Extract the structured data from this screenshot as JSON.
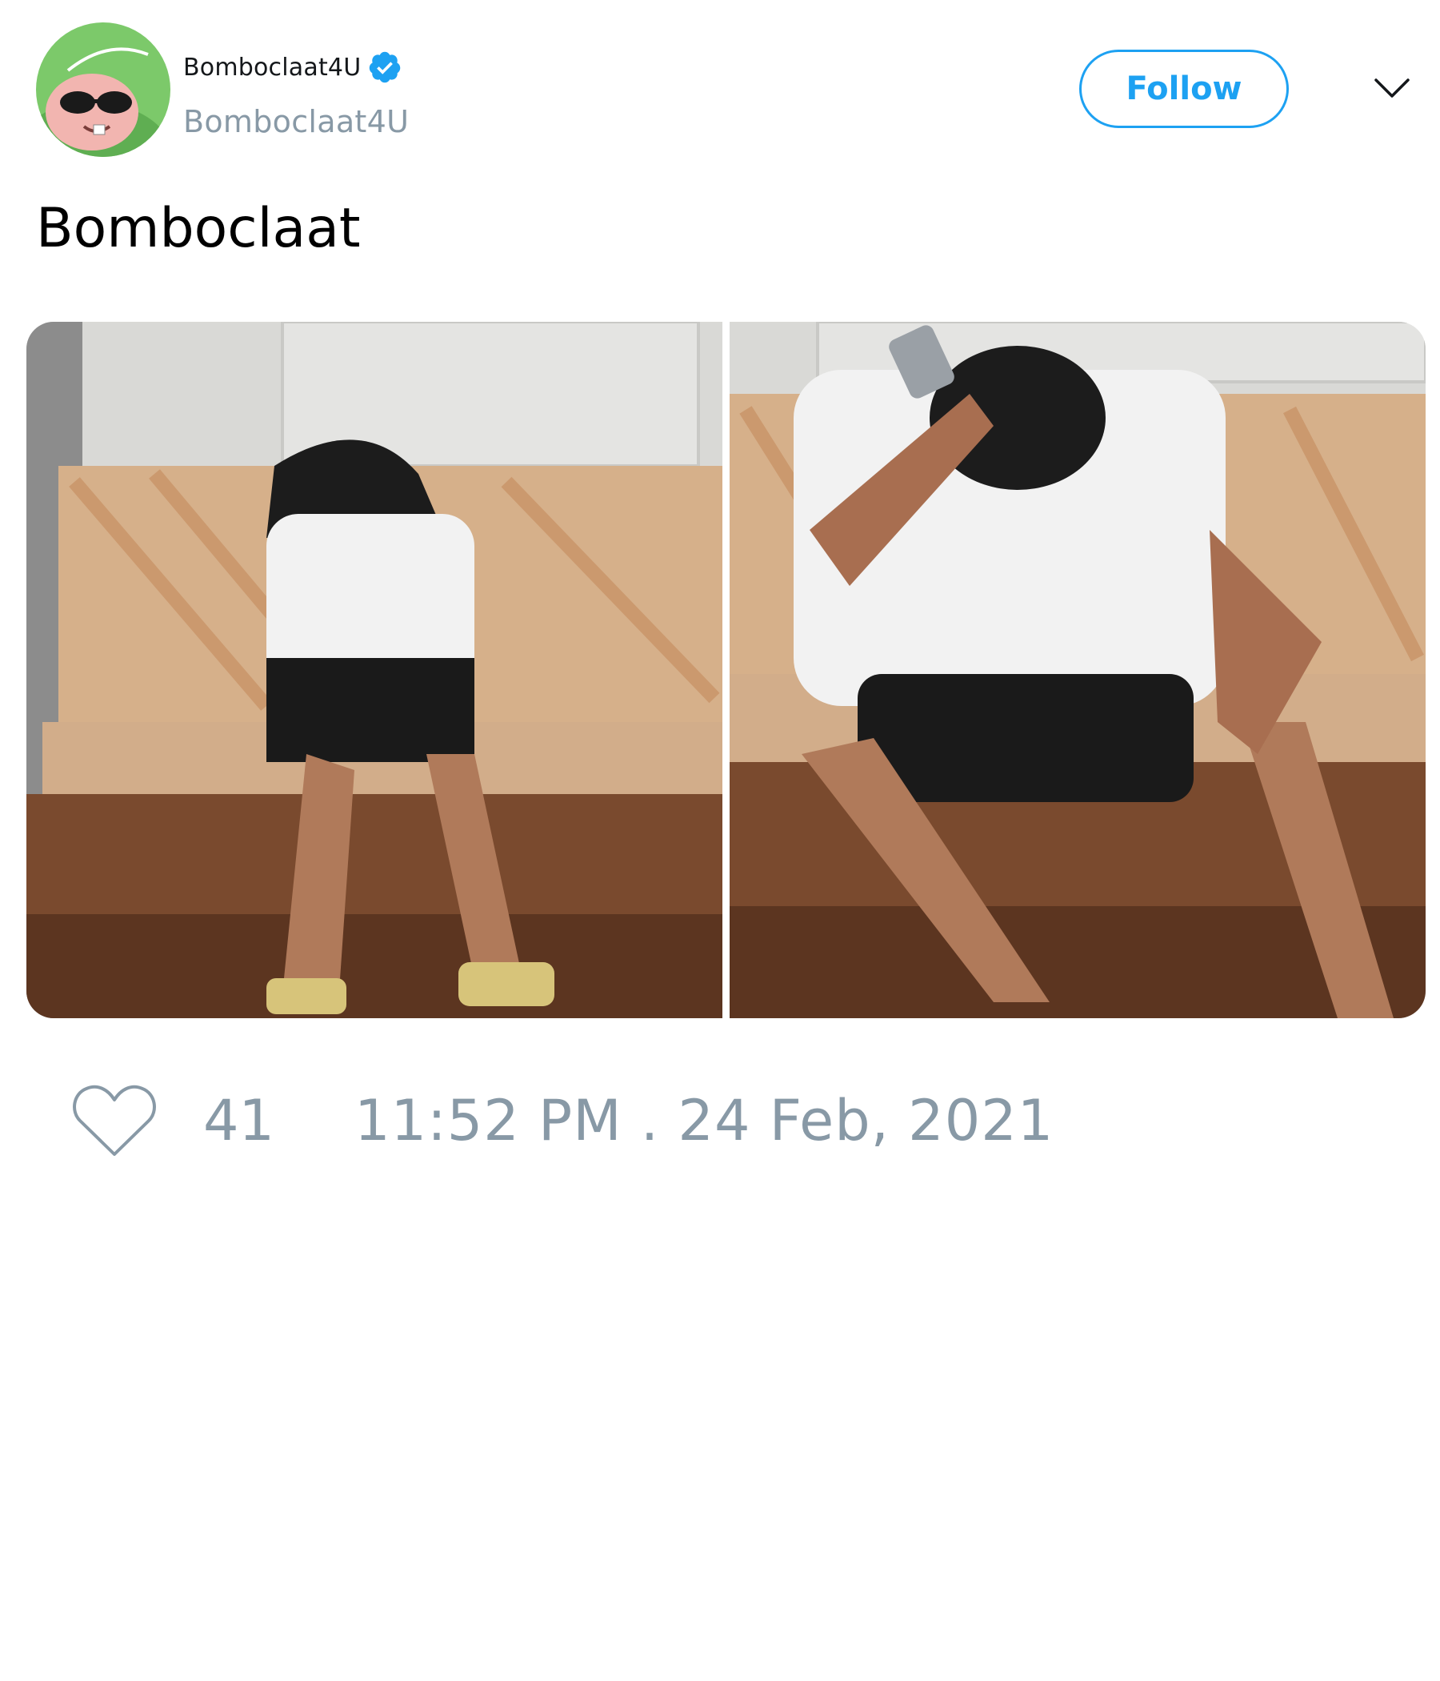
{
  "author": {
    "display_name": "Bomboclaat4U",
    "handle": "Bomboclaat4U",
    "verified": true,
    "avatar_icon": "cartoon-character-sunglasses-avatar"
  },
  "actions": {
    "follow_label": "Follow",
    "more_icon": "chevron-down-icon"
  },
  "tweet": {
    "text": "Bomboclaat",
    "media": [
      {
        "icon": "photo-man-laughing-at-phone"
      },
      {
        "icon": "photo-man-holding-phone-to-head"
      }
    ]
  },
  "stats": {
    "like_icon": "heart-icon",
    "like_count": "41",
    "timestamp": "11:52 PM . 24 Feb, 2021"
  },
  "colors": {
    "accent": "#1da1f2",
    "muted": "#8899a6",
    "text": "#000000"
  }
}
